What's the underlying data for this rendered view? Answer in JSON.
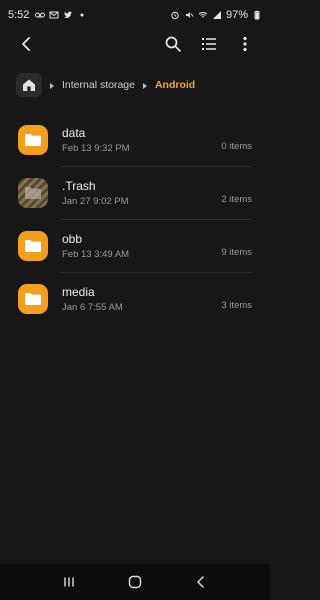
{
  "status_bar": {
    "time": "5:52",
    "battery": "97%",
    "icons": [
      "voicemail-icon",
      "mail-icon",
      "twitter-icon",
      "dot-icon",
      "alarm-icon",
      "mute-icon",
      "wifi-icon",
      "signal-icon",
      "battery-icon"
    ]
  },
  "app_bar": {
    "icons": [
      "back-arrow-icon",
      "search-icon",
      "list-view-icon",
      "more-options-icon"
    ]
  },
  "breadcrumb": {
    "items": [
      "Internal storage",
      "Android"
    ],
    "active_color": "#f4a536"
  },
  "files": [
    {
      "name": "data",
      "date": "Feb 13 9:32 PM",
      "count": "0 items",
      "hidden": false
    },
    {
      "name": ".Trash",
      "date": "Jan 27 9:02 PM",
      "count": "2 items",
      "hidden": true
    },
    {
      "name": "obb",
      "date": "Feb 13 3:49 AM",
      "count": "9 items",
      "hidden": false
    },
    {
      "name": "media",
      "date": "Jan 6 7:55 AM",
      "count": "3 items",
      "hidden": false
    }
  ],
  "colors": {
    "background": "#171717",
    "folder": "#f29f1f",
    "accent": "#f4a536"
  }
}
